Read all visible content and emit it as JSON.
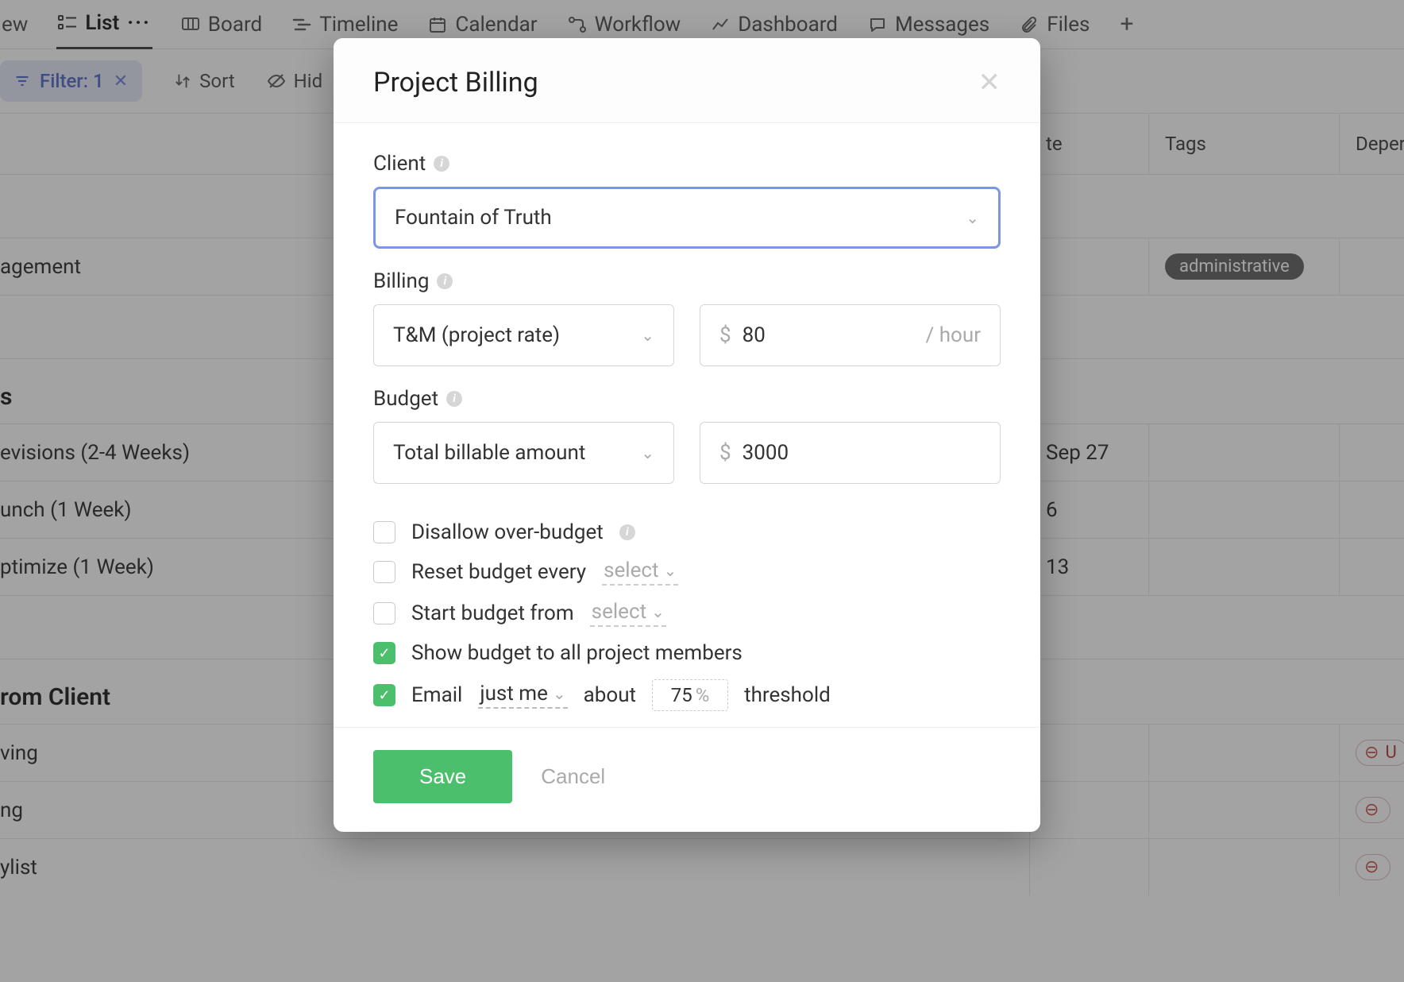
{
  "nav": {
    "overview": "ew",
    "list": "List",
    "board": "Board",
    "timeline": "Timeline",
    "calendar": "Calendar",
    "workflow": "Workflow",
    "dashboard": "Dashboard",
    "messages": "Messages",
    "files": "Files"
  },
  "toolbar": {
    "filter_label": "Filter: 1",
    "sort_label": "Sort",
    "hide_label": "Hid"
  },
  "columns": {
    "date": "te",
    "tags": "Tags",
    "depends": "Deper"
  },
  "rows": {
    "management": "agement",
    "tag_admin": "administrative",
    "section_s": "s",
    "revisions": "evisions (2-4 Weeks)",
    "revisions_date": "Sep 27",
    "launch": "unch (1 Week)",
    "launch_date": "6",
    "optimize": "ptimize (1 Week)",
    "optimize_date": "13",
    "from_client": "rom Client",
    "ving": "ving",
    "ng": "ng",
    "ylist": "ylist",
    "warn_u": "U"
  },
  "modal": {
    "title": "Project Billing",
    "client_label": "Client",
    "client_value": "Fountain of Truth",
    "billing_label": "Billing",
    "billing_type": "T&M (project rate)",
    "billing_rate": "80",
    "billing_unit": "/ hour",
    "currency": "$",
    "budget_label": "Budget",
    "budget_type": "Total billable amount",
    "budget_amount": "3000",
    "check_disallow": "Disallow over-budget",
    "check_reset_prefix": "Reset budget every",
    "check_reset_select": "select",
    "check_start_prefix": "Start budget from",
    "check_start_select": "select",
    "check_show": "Show budget to all project members",
    "check_email_prefix": "Email",
    "check_email_who": "just me",
    "check_email_about": "about",
    "check_email_pct": "75",
    "check_email_pct_sym": "%",
    "check_email_suffix": "threshold",
    "save": "Save",
    "cancel": "Cancel"
  }
}
